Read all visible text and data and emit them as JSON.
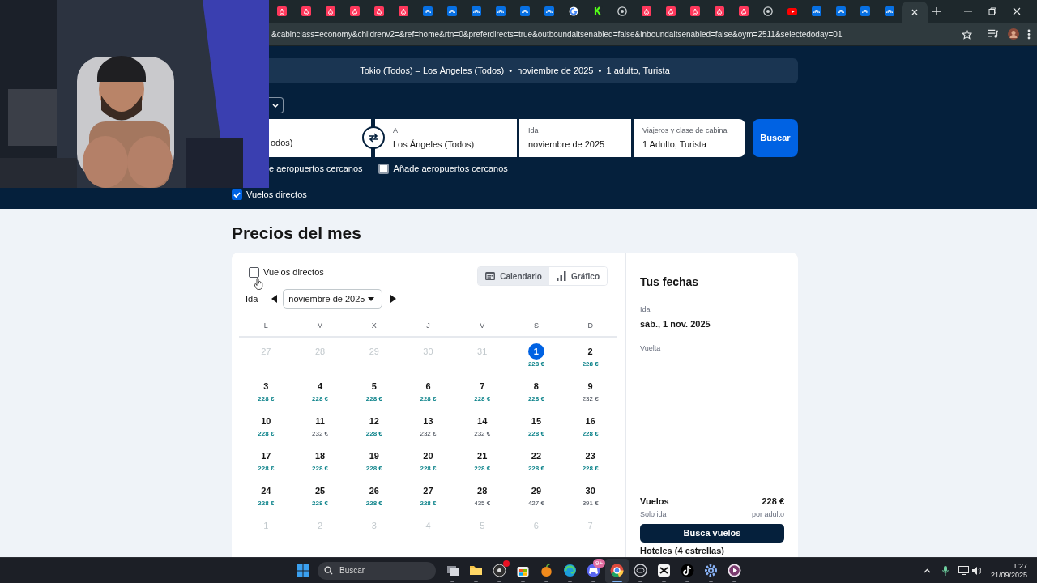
{
  "browser": {
    "tabs": [
      {
        "kind": "pink",
        "selected": false
      },
      {
        "kind": "pink",
        "selected": false
      },
      {
        "kind": "pink",
        "selected": false
      },
      {
        "kind": "pink",
        "selected": false
      },
      {
        "kind": "pink",
        "selected": false
      },
      {
        "kind": "pink",
        "selected": false
      },
      {
        "kind": "blue",
        "selected": false
      },
      {
        "kind": "blue",
        "selected": false
      },
      {
        "kind": "blue",
        "selected": false
      },
      {
        "kind": "blue",
        "selected": false
      },
      {
        "kind": "blue",
        "selected": false
      },
      {
        "kind": "blue",
        "selected": false
      },
      {
        "kind": "ring",
        "selected": false
      },
      {
        "kind": "green",
        "selected": false
      },
      {
        "kind": "globe",
        "selected": false
      },
      {
        "kind": "pink",
        "selected": false
      },
      {
        "kind": "pink",
        "selected": false
      },
      {
        "kind": "pink",
        "selected": false
      },
      {
        "kind": "pink",
        "selected": false
      },
      {
        "kind": "pink",
        "selected": false
      },
      {
        "kind": "globe",
        "selected": false
      },
      {
        "kind": "red",
        "selected": false
      },
      {
        "kind": "blue",
        "selected": false
      },
      {
        "kind": "blue",
        "selected": false
      },
      {
        "kind": "blue",
        "selected": false
      },
      {
        "kind": "blue",
        "selected": false
      },
      {
        "selected": true
      }
    ],
    "url": "&cabinclass=economy&childrenv2=&ref=home&rtn=0&preferdirects=true&outboundaltsenabled=false&inboundaltsenabled=false&oym=2511&selectedoday=01"
  },
  "summary": "Tokio (Todos) – Los Ángeles (Todos)  •  noviembre de 2025  •  1 adulto, Turista",
  "search": {
    "origin_value": "odos)",
    "destination_label": "A",
    "destination_value": "Los Ángeles (Todos)",
    "date_label": "Ida",
    "date_value": "noviembre de 2025",
    "travellers_label": "Viajeros y clase de cabina",
    "travellers_value": "1 Adulto, Turista",
    "button": "Buscar"
  },
  "origin_nearby_label": "e aeropuertos cercanos",
  "destination_nearby": {
    "label": "Añade aeropuertos cercanos",
    "checked": false
  },
  "direct_flights": {
    "label": "Vuelos directos",
    "checked": true
  },
  "month_prices": {
    "title": "Precios del mes",
    "direct_flights": {
      "label": "Vuelos directos",
      "checked": false
    },
    "views": [
      {
        "kind": "calendar",
        "label": "Calendario",
        "selected": true
      },
      {
        "kind": "chart",
        "label": "Gráfico",
        "selected": false
      }
    ],
    "trip_label": "Ida",
    "month": "noviembre de 2025",
    "weekdays": [
      "L",
      "M",
      "X",
      "J",
      "V",
      "S",
      "D"
    ],
    "weeks": [
      [
        {
          "day": "27",
          "muted": true,
          "selected": false
        },
        {
          "day": "28",
          "muted": true,
          "selected": false
        },
        {
          "day": "29",
          "muted": true,
          "selected": false
        },
        {
          "day": "30",
          "muted": true,
          "selected": false
        },
        {
          "day": "31",
          "muted": true,
          "selected": false
        },
        {
          "day": "1",
          "muted": false,
          "selected": true,
          "price": "228 €",
          "cheap": true
        },
        {
          "day": "2",
          "muted": false,
          "selected": false,
          "price": "228 €",
          "cheap": true
        }
      ],
      [
        {
          "day": "3",
          "muted": false,
          "selected": false,
          "price": "228 €",
          "cheap": true
        },
        {
          "day": "4",
          "muted": false,
          "selected": false,
          "price": "228 €",
          "cheap": true
        },
        {
          "day": "5",
          "muted": false,
          "selected": false,
          "price": "228 €",
          "cheap": true
        },
        {
          "day": "6",
          "muted": false,
          "selected": false,
          "price": "228 €",
          "cheap": true
        },
        {
          "day": "7",
          "muted": false,
          "selected": false,
          "price": "228 €",
          "cheap": true
        },
        {
          "day": "8",
          "muted": false,
          "selected": false,
          "price": "228 €",
          "cheap": true
        },
        {
          "day": "9",
          "muted": false,
          "selected": false,
          "price": "232 €",
          "cheap": false
        }
      ],
      [
        {
          "day": "10",
          "muted": false,
          "selected": false,
          "price": "228 €",
          "cheap": true
        },
        {
          "day": "11",
          "muted": false,
          "selected": false,
          "price": "232 €",
          "cheap": false
        },
        {
          "day": "12",
          "muted": false,
          "selected": false,
          "price": "228 €",
          "cheap": true
        },
        {
          "day": "13",
          "muted": false,
          "selected": false,
          "price": "232 €",
          "cheap": false
        },
        {
          "day": "14",
          "muted": false,
          "selected": false,
          "price": "232 €",
          "cheap": false
        },
        {
          "day": "15",
          "muted": false,
          "selected": false,
          "price": "228 €",
          "cheap": true
        },
        {
          "day": "16",
          "muted": false,
          "selected": false,
          "price": "228 €",
          "cheap": true
        }
      ],
      [
        {
          "day": "17",
          "muted": false,
          "selected": false,
          "price": "228 €",
          "cheap": true
        },
        {
          "day": "18",
          "muted": false,
          "selected": false,
          "price": "228 €",
          "cheap": true
        },
        {
          "day": "19",
          "muted": false,
          "selected": false,
          "price": "228 €",
          "cheap": true
        },
        {
          "day": "20",
          "muted": false,
          "selected": false,
          "price": "228 €",
          "cheap": true
        },
        {
          "day": "21",
          "muted": false,
          "selected": false,
          "price": "228 €",
          "cheap": true
        },
        {
          "day": "22",
          "muted": false,
          "selected": false,
          "price": "228 €",
          "cheap": true
        },
        {
          "day": "23",
          "muted": false,
          "selected": false,
          "price": "228 €",
          "cheap": true
        }
      ],
      [
        {
          "day": "24",
          "muted": false,
          "selected": false,
          "price": "228 €",
          "cheap": true
        },
        {
          "day": "25",
          "muted": false,
          "selected": false,
          "price": "228 €",
          "cheap": true
        },
        {
          "day": "26",
          "muted": false,
          "selected": false,
          "price": "228 €",
          "cheap": true
        },
        {
          "day": "27",
          "muted": false,
          "selected": false,
          "price": "228 €",
          "cheap": true
        },
        {
          "day": "28",
          "muted": false,
          "selected": false,
          "price": "435 €",
          "cheap": false
        },
        {
          "day": "29",
          "muted": false,
          "selected": false,
          "price": "427 €",
          "cheap": false
        },
        {
          "day": "30",
          "muted": false,
          "selected": false,
          "price": "391 €",
          "cheap": false
        }
      ],
      [
        {
          "day": "1",
          "muted": true,
          "selected": false
        },
        {
          "day": "2",
          "muted": true,
          "selected": false
        },
        {
          "day": "3",
          "muted": true,
          "selected": false
        },
        {
          "day": "4",
          "muted": true,
          "selected": false
        },
        {
          "day": "5",
          "muted": true,
          "selected": false
        },
        {
          "day": "6",
          "muted": true,
          "selected": false
        },
        {
          "day": "7",
          "muted": true,
          "selected": false
        }
      ]
    ]
  },
  "your_dates": {
    "title": "Tus fechas",
    "outbound_label": "Ida",
    "outbound_value": "sáb., 1 nov. 2025",
    "return_label": "Vuelta",
    "flights_label": "Vuelos",
    "flights_price": "228 €",
    "trip_type": "Solo ida",
    "price_basis": "por adulto",
    "button": "Busca vuelos",
    "hotels_label": "Hoteles (4 estrellas)"
  },
  "taskbar": {
    "search_placeholder": "Buscar",
    "apps": [
      {
        "kind": "stack",
        "active": false,
        "notification": false
      },
      {
        "kind": "folder",
        "active": false,
        "notification": false
      },
      {
        "kind": "disc",
        "active": false,
        "notification": true
      },
      {
        "kind": "bag",
        "active": false,
        "notification": false
      },
      {
        "kind": "fruit",
        "active": false,
        "notification": false
      },
      {
        "kind": "wave",
        "active": false,
        "notification": false
      },
      {
        "kind": "controller",
        "active": false,
        "notification": true,
        "badge": "9+"
      },
      {
        "kind": "ring",
        "active": true,
        "notification": false
      },
      {
        "kind": "lens",
        "active": false,
        "notification": false
      },
      {
        "kind": "clapper",
        "active": false,
        "notification": false
      },
      {
        "kind": "note",
        "active": false,
        "notification": false
      },
      {
        "kind": "gear",
        "active": false,
        "notification": false
      },
      {
        "kind": "play",
        "active": false,
        "notification": false
      }
    ],
    "time": "1:27",
    "date": "21/09/2025"
  }
}
